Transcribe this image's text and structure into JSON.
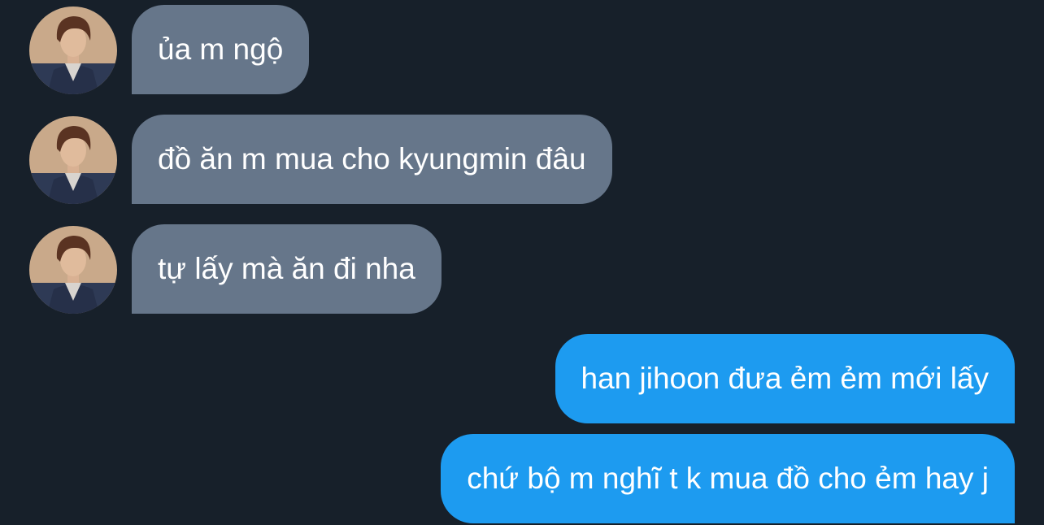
{
  "colors": {
    "background": "#17202a",
    "received_bubble": "#66768a",
    "sent_bubble": "#1d9bf0",
    "text": "#ffffff"
  },
  "participant": {
    "avatar_icon": "user-avatar-photo"
  },
  "messages": [
    {
      "direction": "received",
      "text": "ủa m ngộ"
    },
    {
      "direction": "received",
      "text": "đồ ăn m mua cho kyungmin đâu"
    },
    {
      "direction": "received",
      "text": "tự lấy mà ăn đi nha"
    },
    {
      "direction": "sent",
      "text": "han jihoon đưa ẻm ẻm mới lấy"
    },
    {
      "direction": "sent",
      "text": "chứ bộ m nghĩ t k mua đồ cho ẻm hay j"
    }
  ]
}
